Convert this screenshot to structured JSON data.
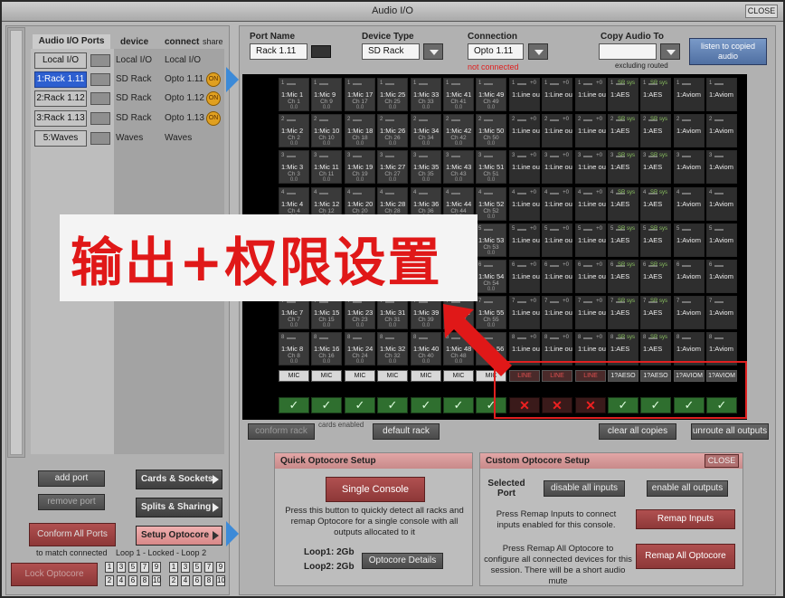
{
  "window": {
    "title": "Audio I/O",
    "close_label": "CLOSE"
  },
  "left": {
    "ports_header": "Audio I/O Ports",
    "col_device": "device",
    "col_connect": "connect",
    "col_share": "share",
    "ports": [
      {
        "name": "Local I/O",
        "device": "Local I/O",
        "connect": "Local I/O",
        "shared": false,
        "selected": false
      },
      {
        "name": "1:Rack 1.11",
        "device": "SD Rack",
        "connect": "Opto 1.11",
        "shared": true,
        "selected": true
      },
      {
        "name": "2:Rack 1.12",
        "device": "SD Rack",
        "connect": "Opto 1.12",
        "shared": true,
        "selected": false
      },
      {
        "name": "3:Rack 1.13",
        "device": "SD Rack",
        "connect": "Opto 1.13",
        "shared": true,
        "selected": false
      },
      {
        "name": "5:Waves",
        "device": "Waves",
        "connect": "Waves",
        "shared": false,
        "selected": false
      }
    ],
    "add_port": "add port",
    "remove_port": "remove port",
    "cards_sockets": "Cards & Sockets",
    "splits_sharing": "Splits & Sharing",
    "setup_optocore": "Setup Optocore",
    "conform_all_ports": "Conform All Ports",
    "to_match_connected": "to match connected",
    "loop_status": "Loop 1 - Locked - Loop 2",
    "lock_optocore": "Lock Optocore",
    "loop_top": [
      "1",
      "3",
      "5",
      "7",
      "9",
      "1",
      "3",
      "5",
      "7",
      "9"
    ],
    "loop_bottom": [
      "2",
      "4",
      "6",
      "8",
      "10",
      "2",
      "4",
      "6",
      "8",
      "10"
    ]
  },
  "right": {
    "port_name_label": "Port Name",
    "port_name_value": "Rack 1.11",
    "device_type_label": "Device Type",
    "device_type_value": "SD Rack",
    "connection_label": "Connection",
    "connection_value": "Opto 1.11",
    "connection_status": "not connected",
    "copy_audio_label": "Copy Audio To",
    "copy_audio_value": "",
    "excluding_routed": "excluding routed",
    "listen_btn": "listen to copied audio",
    "columns": [
      {
        "prefix": "1:Mic",
        "start": 1,
        "type": "MIC",
        "status": "ok",
        "style": "mic"
      },
      {
        "prefix": "1:Mic",
        "start": 9,
        "type": "MIC",
        "status": "ok",
        "style": "mic"
      },
      {
        "prefix": "1:Mic",
        "start": 17,
        "type": "MIC",
        "status": "ok",
        "style": "mic"
      },
      {
        "prefix": "1:Mic",
        "start": 25,
        "type": "MIC",
        "status": "ok",
        "style": "mic"
      },
      {
        "prefix": "1:Mic",
        "start": 33,
        "type": "MIC",
        "status": "ok",
        "style": "mic"
      },
      {
        "prefix": "1:Mic",
        "start": 41,
        "type": "MIC",
        "status": "ok",
        "style": "mic"
      },
      {
        "prefix": "1:Mic",
        "start": 49,
        "type": "MIC",
        "status": "ok",
        "style": "mic"
      },
      {
        "prefix": "1:Line ou",
        "start": 1,
        "type": "LINE",
        "status": "x",
        "style": "line"
      },
      {
        "prefix": "1:Line ou",
        "start": 1,
        "type": "LINE",
        "status": "x",
        "style": "line"
      },
      {
        "prefix": "1:Line ou",
        "start": 1,
        "type": "LINE",
        "status": "x",
        "style": "line"
      },
      {
        "prefix": "1:AES",
        "start": 1,
        "type": "1?AESO",
        "status": "ok",
        "style": "aes"
      },
      {
        "prefix": "1:AES",
        "start": 1,
        "type": "1?AESO",
        "status": "ok",
        "style": "aes"
      },
      {
        "prefix": "1:Aviom",
        "start": 1,
        "type": "1?AVIOM",
        "status": "ok",
        "style": "aviom"
      },
      {
        "prefix": "1:Aviom",
        "start": 1,
        "type": "1?AVIOM",
        "status": "ok",
        "style": "aviom"
      }
    ],
    "conform_rack": "conform rack",
    "cards_enabled": "cards enabled",
    "default_rack": "default rack",
    "clear_all_copies": "clear all copies",
    "unroute_all_outputs": "unroute all outputs",
    "quick": {
      "title": "Quick Optocore Setup",
      "single_console": "Single Console",
      "desc": "Press this button to quickly detect all racks and remap Optocore for a single console with all outputs allocated to it",
      "loop1": "Loop1: 2Gb",
      "loop2": "Loop2: 2Gb",
      "details": "Optocore Details"
    },
    "custom": {
      "title": "Custom Optocore Setup",
      "close": "CLOSE",
      "selected_port": "Selected Port",
      "disable_all_inputs": "disable all inputs",
      "enable_all_outputs": "enable all outputs",
      "remap_desc": "Press Remap Inputs to connect inputs enabled for this console.",
      "remap_inputs": "Remap Inputs",
      "remap_all_desc": "Press Remap All Optocore to configure all connected devices for this session. There will be a short audio mute",
      "remap_all": "Remap All Optocore"
    }
  },
  "overlay_text": "输出+权限设置",
  "colors": {
    "selected_port": "#2d5fd0",
    "not_connected": "#e02020",
    "annotation": "#e01818",
    "accent_arrow": "#3c8ad8"
  }
}
